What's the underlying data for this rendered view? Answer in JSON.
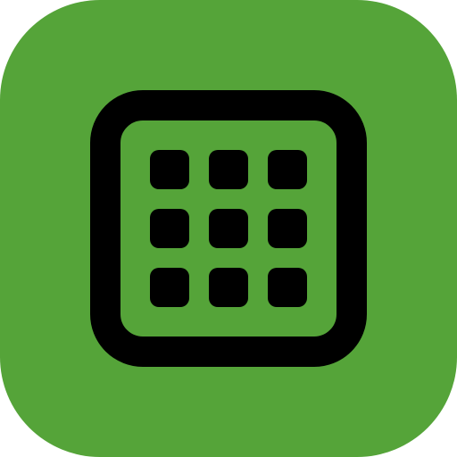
{
  "icon": {
    "name": "grid-icon",
    "background_color": "#55A439",
    "glyph_color": "#000000",
    "grid_rows": 3,
    "grid_columns": 3
  }
}
